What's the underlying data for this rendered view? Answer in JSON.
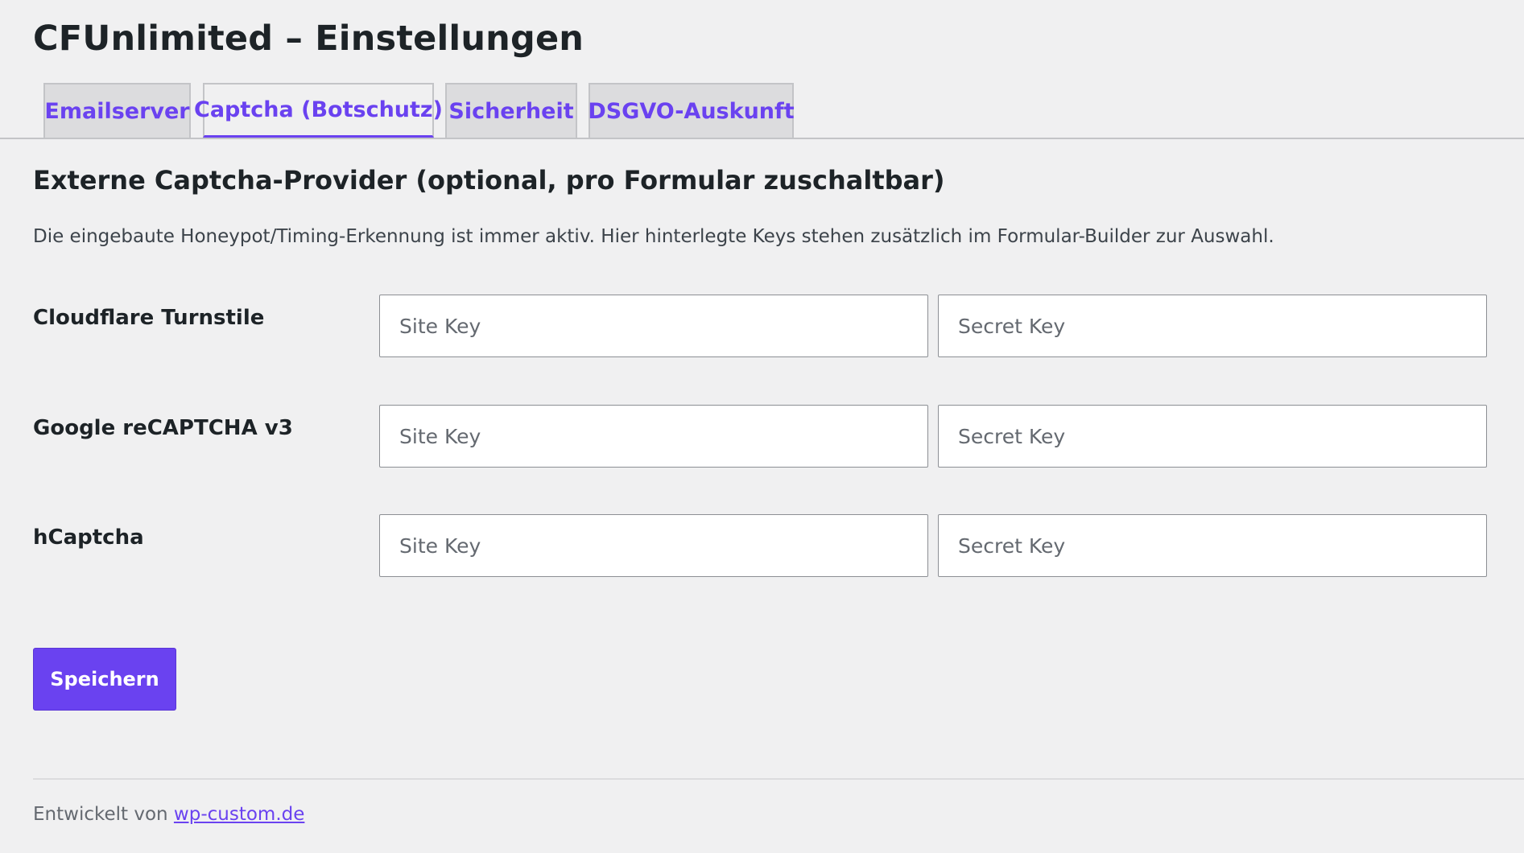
{
  "page": {
    "title": "CFUnlimited – Einstellungen"
  },
  "tabs": [
    {
      "label": "Emailserver",
      "active": false
    },
    {
      "label": "Captcha (Botschutz)",
      "active": true
    },
    {
      "label": "Sicherheit",
      "active": false
    },
    {
      "label": "DSGVO-Auskunft",
      "active": false
    }
  ],
  "section": {
    "title": "Externe Captcha-Provider (optional, pro Formular zuschaltbar)",
    "description": "Die eingebaute Honeypot/Timing-Erkennung ist immer aktiv. Hier hinterlegte Keys stehen zusätzlich im Formular-Builder zur Auswahl."
  },
  "providers": [
    {
      "label": "Cloudflare Turnstile",
      "site_key_value": "",
      "site_key_placeholder": "Site Key",
      "secret_key_value": "",
      "secret_key_placeholder": "Secret Key"
    },
    {
      "label": "Google reCAPTCHA v3",
      "site_key_value": "",
      "site_key_placeholder": "Site Key",
      "secret_key_value": "",
      "secret_key_placeholder": "Secret Key"
    },
    {
      "label": "hCaptcha",
      "site_key_value": "",
      "site_key_placeholder": "Site Key",
      "secret_key_value": "",
      "secret_key_placeholder": "Secret Key"
    }
  ],
  "actions": {
    "save_label": "Speichern"
  },
  "footer": {
    "prefix": "Entwickelt von ",
    "link_text": "wp-custom.de"
  },
  "colors": {
    "accent": "#6a42f0",
    "background": "#f0f0f1",
    "tab_inactive": "#dcdcde",
    "border": "#c3c4c7"
  }
}
